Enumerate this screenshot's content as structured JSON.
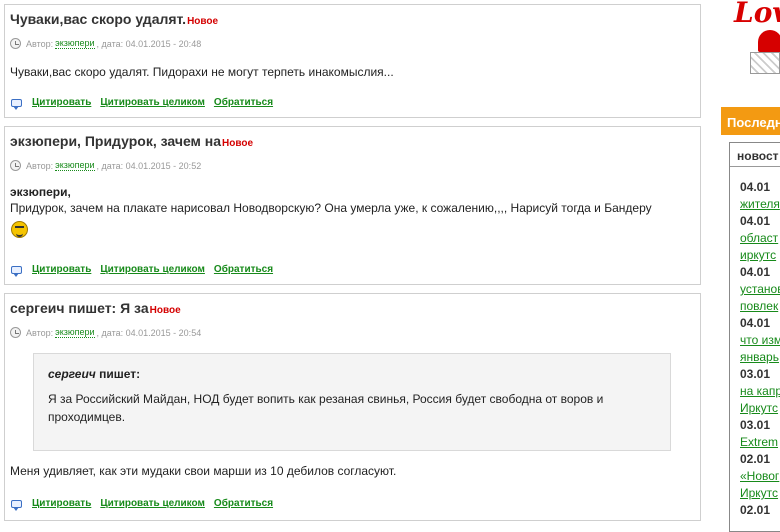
{
  "posts": [
    {
      "title": "Чуваки,вас скоро удалят.",
      "badge": "Новое",
      "author_prefix": "Автор:",
      "author": "экзюпери",
      "date_text": ", дата: 04.01.2015 - 20:48",
      "body": "Чуваки,вас скоро удалят. Пидорахи не могут терпеть инакомыслия..."
    },
    {
      "title": "экзюпери, Придурок, зачем на",
      "badge": "Новое",
      "author_prefix": "Автор:",
      "author": "экзюпери",
      "date_text": ", дата: 04.01.2015 - 20:52",
      "addressee": "экзюпери,",
      "body": "Придурок, зачем на плакате нарисовал Новодворскую? Она умерла уже, к сожалению,,,, Нарисуй тогда и Бандеру"
    },
    {
      "title": "сергеич пишет: Я за",
      "badge": "Новое",
      "author_prefix": "Автор:",
      "author": "экзюпери",
      "date_text": ", дата: 04.01.2015 - 20:54",
      "quote_author": "сергеич",
      "quote_says": " пишет:",
      "quote_text": "Я за Российский Майдан, НОД будет вопить как резаная свинья, Россия будет свободна от воров и проходимцев.",
      "body": "Меня удивляет, как эти мудаки свои марши из 10 дебилов согласуют."
    }
  ],
  "actions": {
    "quote": "Цитировать",
    "quote_all": "Цитировать целиком",
    "reply": "Обратиться"
  },
  "sidebar": {
    "logo_text": "Lov",
    "header": "Последн",
    "tab": "новост",
    "news": [
      {
        "date": "04.01",
        "lines": [
          "жителя"
        ]
      },
      {
        "date": "04.01",
        "lines": [
          "област",
          "иркутс"
        ]
      },
      {
        "date": "04.01",
        "lines": [
          "установ",
          "повлек"
        ]
      },
      {
        "date": "04.01",
        "lines": [
          "что изм",
          "январь"
        ]
      },
      {
        "date": "03.01",
        "lines": [
          "на капр",
          "Иркутс"
        ]
      },
      {
        "date": "03.01",
        "lines": [
          "Extrem"
        ]
      },
      {
        "date": "02.01",
        "lines": [
          "«Новог",
          "Иркутс"
        ]
      },
      {
        "date": "02.01",
        "lines": []
      }
    ]
  },
  "colors": {
    "link_green": "#178a1a",
    "new_red": "#d40000",
    "sidebar_orange": "#f39a12"
  }
}
